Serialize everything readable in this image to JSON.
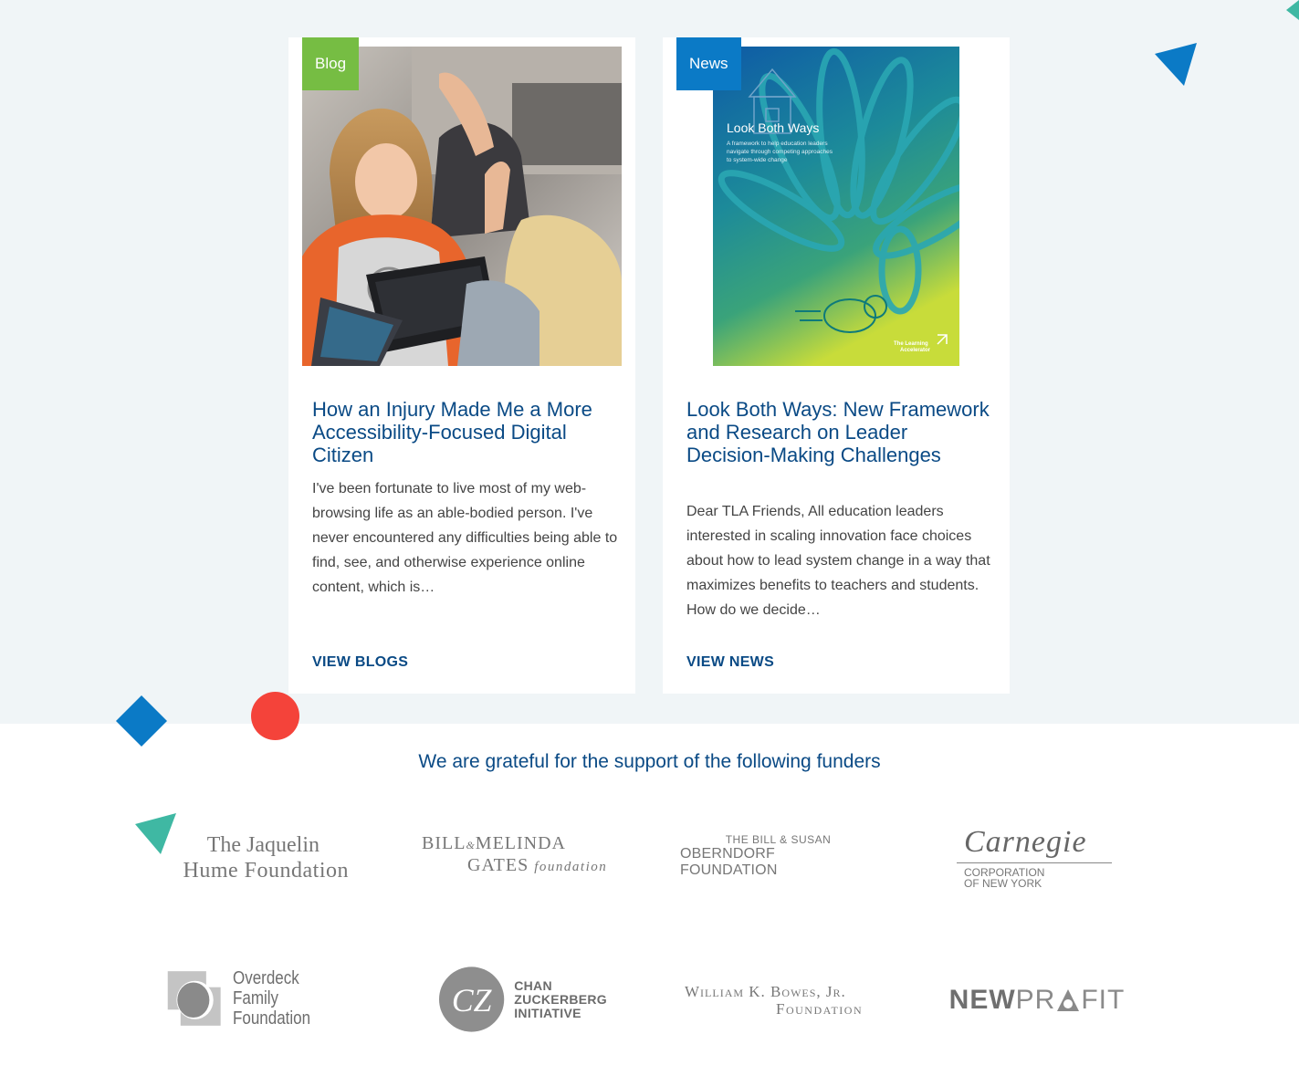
{
  "cards": [
    {
      "tag": "Blog",
      "title": "How an Injury Made Me a More Accessibility-Focused Digital Citizen",
      "excerpt": "I've been fortunate to live most of my web-browsing life as an able-bodied person. I've never encountered any difficulties being able to find, see, and otherwise experience online content, which is…",
      "link": "VIEW BLOGS"
    },
    {
      "tag": "News",
      "title": "Look Both Ways: New Framework and Research on Leader Decision-Making Challenges",
      "excerpt": "Dear TLA Friends, All education leaders interested in scaling innovation face choices about how to lead system change in a way that maximizes benefits to teachers and students. How do we decide…",
      "link": "VIEW NEWS",
      "cover": {
        "title": "Look Both Ways",
        "subtitle": "A framework to help education leaders navigate through competing approaches to system-wide change",
        "brand_line1": "The Learning",
        "brand_line2": "Accelerator"
      }
    }
  ],
  "funders": {
    "heading": "We are grateful for the support of the following funders",
    "jaquelin": [
      "The Jaquelin",
      "Hume Foundation"
    ],
    "gates": {
      "bill": "BILL",
      "amp": "&",
      "melinda": "MELINDA",
      "gates": "GATES",
      "foundation": "foundation"
    },
    "oberndorf": [
      "THE BILL & SUSAN",
      "OBERNDORF FOUNDATION"
    ],
    "carnegie": {
      "script": "Carnegie",
      "line1": "CORPORATION",
      "line2": "OF NEW YORK"
    },
    "overdeck": [
      "Overdeck Family",
      "Foundation"
    ],
    "czi": {
      "mark": "CZ",
      "lines": [
        "CHAN",
        "ZUCKERBERG",
        "INITIATIVE"
      ]
    },
    "bowes": [
      "William K. Bowes, Jr.",
      "Foundation"
    ],
    "newprofit": {
      "new": "NEW",
      "pr": "PR",
      "fit": "FIT"
    }
  },
  "colors": {
    "band": "#f0f5f7",
    "heading": "#0a4a85",
    "blog_tag": "#76bd43",
    "news_tag": "#0b7ac6",
    "deco_blue": "#0b7ac6",
    "deco_red": "#f4433a",
    "deco_teal": "#3fb8a3"
  }
}
